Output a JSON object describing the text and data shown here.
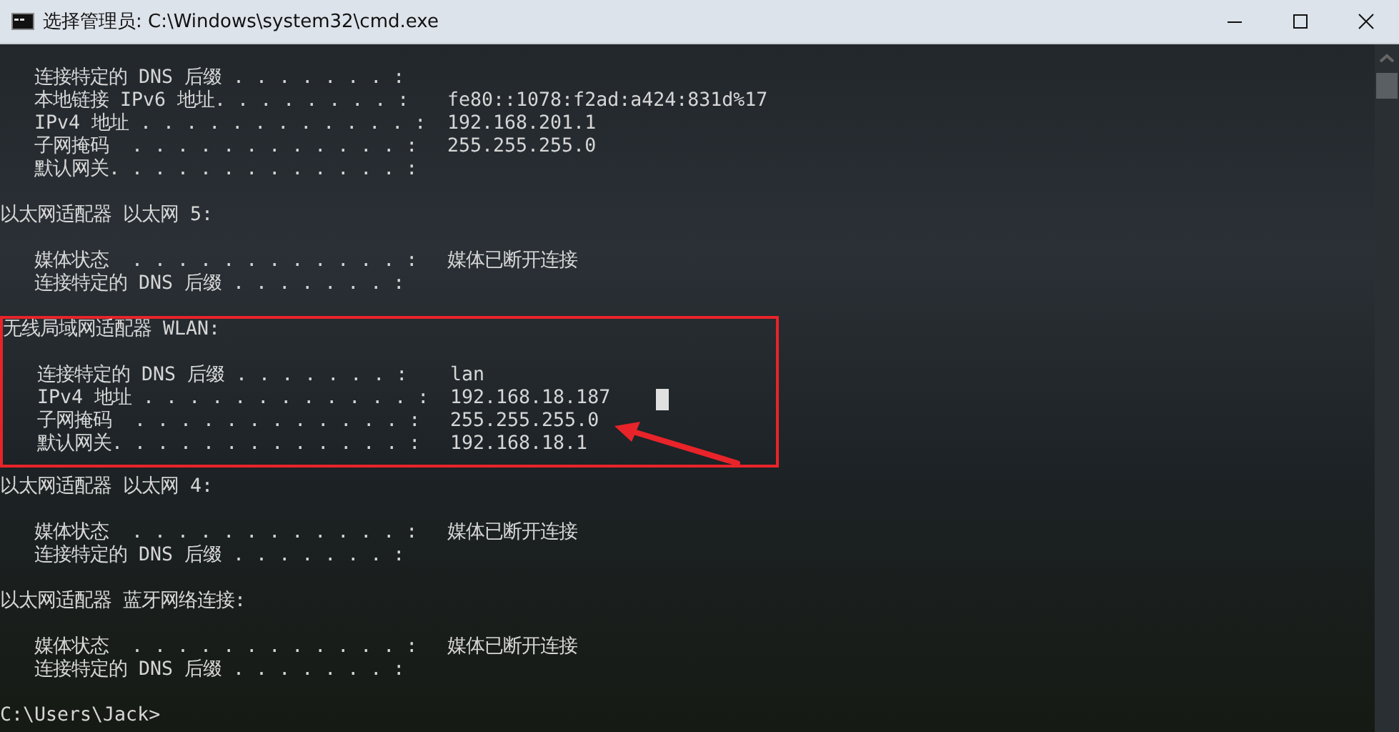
{
  "window": {
    "title": "选择管理员: C:\\Windows\\system32\\cmd.exe"
  },
  "console": {
    "sections": [
      {
        "highlighted": false,
        "arrow": false,
        "lines": [
          {
            "kind": "entry",
            "label": "   连接特定的 DNS 后缀 . . . . . . . :",
            "cursor": false
          },
          {
            "kind": "entry",
            "label": "   本地链接 IPv6 地址. . . . . . . . :",
            "value": "fe80::1078:f2ad:a424:831d%17",
            "cursor": false
          },
          {
            "kind": "entry",
            "label": "   IPv4 地址 . . . . . . . . . . . . :",
            "value": "192.168.201.1",
            "cursor": false
          },
          {
            "kind": "entry",
            "label": "   子网掩码  . . . . . . . . . . . . :",
            "value": "255.255.255.0",
            "cursor": false
          },
          {
            "kind": "entry",
            "label": "   默认网关. . . . . . . . . . . . . :",
            "cursor": false
          },
          {
            "kind": "blank"
          },
          {
            "kind": "heading",
            "text": "以太网适配器 以太网 5:"
          },
          {
            "kind": "blank"
          },
          {
            "kind": "entry",
            "label": "   媒体状态  . . . . . . . . . . . . :",
            "value": "媒体已断开连接",
            "cursor": false
          },
          {
            "kind": "entry",
            "label": "   连接特定的 DNS 后缀 . . . . . . . :",
            "cursor": false
          },
          {
            "kind": "blank"
          }
        ]
      },
      {
        "highlighted": true,
        "arrow": true,
        "lines": [
          {
            "kind": "heading",
            "text": "无线局域网适配器 WLAN:"
          },
          {
            "kind": "blank"
          },
          {
            "kind": "entry",
            "label": "   连接特定的 DNS 后缀 . . . . . . . :",
            "value": "lan",
            "cursor": false
          },
          {
            "kind": "entry",
            "label": "   IPv4 地址 . . . . . . . . . . . . :",
            "value": "192.168.18.187",
            "cursor": true
          },
          {
            "kind": "entry",
            "label": "   子网掩码  . . . . . . . . . . . . :",
            "value": "255.255.255.0",
            "cursor": false
          },
          {
            "kind": "entry",
            "label": "   默认网关. . . . . . . . . . . . . :",
            "value": "192.168.18.1",
            "cursor": false
          }
        ]
      },
      {
        "highlighted": false,
        "arrow": false,
        "lines": [
          {
            "kind": "blank"
          },
          {
            "kind": "heading",
            "text": "以太网适配器 以太网 4:"
          },
          {
            "kind": "blank"
          },
          {
            "kind": "entry",
            "label": "   媒体状态  . . . . . . . . . . . . :",
            "value": "媒体已断开连接",
            "cursor": false
          },
          {
            "kind": "entry",
            "label": "   连接特定的 DNS 后缀 . . . . . . . :",
            "cursor": false
          },
          {
            "kind": "blank"
          },
          {
            "kind": "heading",
            "text": "以太网适配器 蓝牙网络连接:"
          },
          {
            "kind": "blank"
          },
          {
            "kind": "entry",
            "label": "   媒体状态  . . . . . . . . . . . . :",
            "value": "媒体已断开连接",
            "cursor": false
          },
          {
            "kind": "entry",
            "label": "   连接特定的 DNS 后缀 . . . . . . . :",
            "cursor": false
          },
          {
            "kind": "blank"
          },
          {
            "kind": "prompt",
            "text": "C:\\Users\\Jack>"
          }
        ]
      }
    ]
  }
}
